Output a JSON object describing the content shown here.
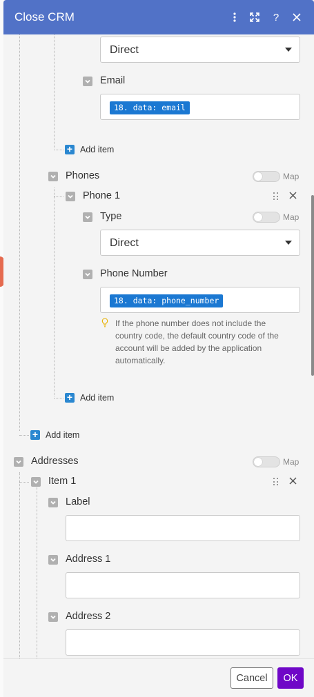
{
  "window": {
    "title": "Close CRM",
    "icons": [
      "more-vertical-icon",
      "expand-icon",
      "help-icon",
      "close-icon"
    ],
    "help_glyph": "?"
  },
  "emails": {
    "type_select": {
      "value": "Direct"
    },
    "email_label": "Email",
    "email_value": "18. data: email",
    "add_item": "Add item"
  },
  "phones": {
    "label": "Phones",
    "map_label": "Map",
    "item_label": "Phone 1",
    "type_label": "Type",
    "type_map_label": "Map",
    "type_select": {
      "value": "Direct"
    },
    "number_label": "Phone Number",
    "number_value": "18. data: phone_number",
    "hint": "If the phone number does not include the country code, the default country code of the account will be added by the application automatically.",
    "add_item": "Add item"
  },
  "outer_add_item": "Add item",
  "addresses": {
    "label": "Addresses",
    "map_label": "Map",
    "item_label": "Item 1",
    "label_field": "Label",
    "address1_field": "Address 1",
    "address2_field": "Address 2"
  },
  "footer": {
    "cancel": "Cancel",
    "ok": "OK"
  },
  "colors": {
    "header": "#5172c7",
    "token": "#1b78d2",
    "ok_button": "#6f07c7",
    "add_button": "#2a87d0"
  }
}
